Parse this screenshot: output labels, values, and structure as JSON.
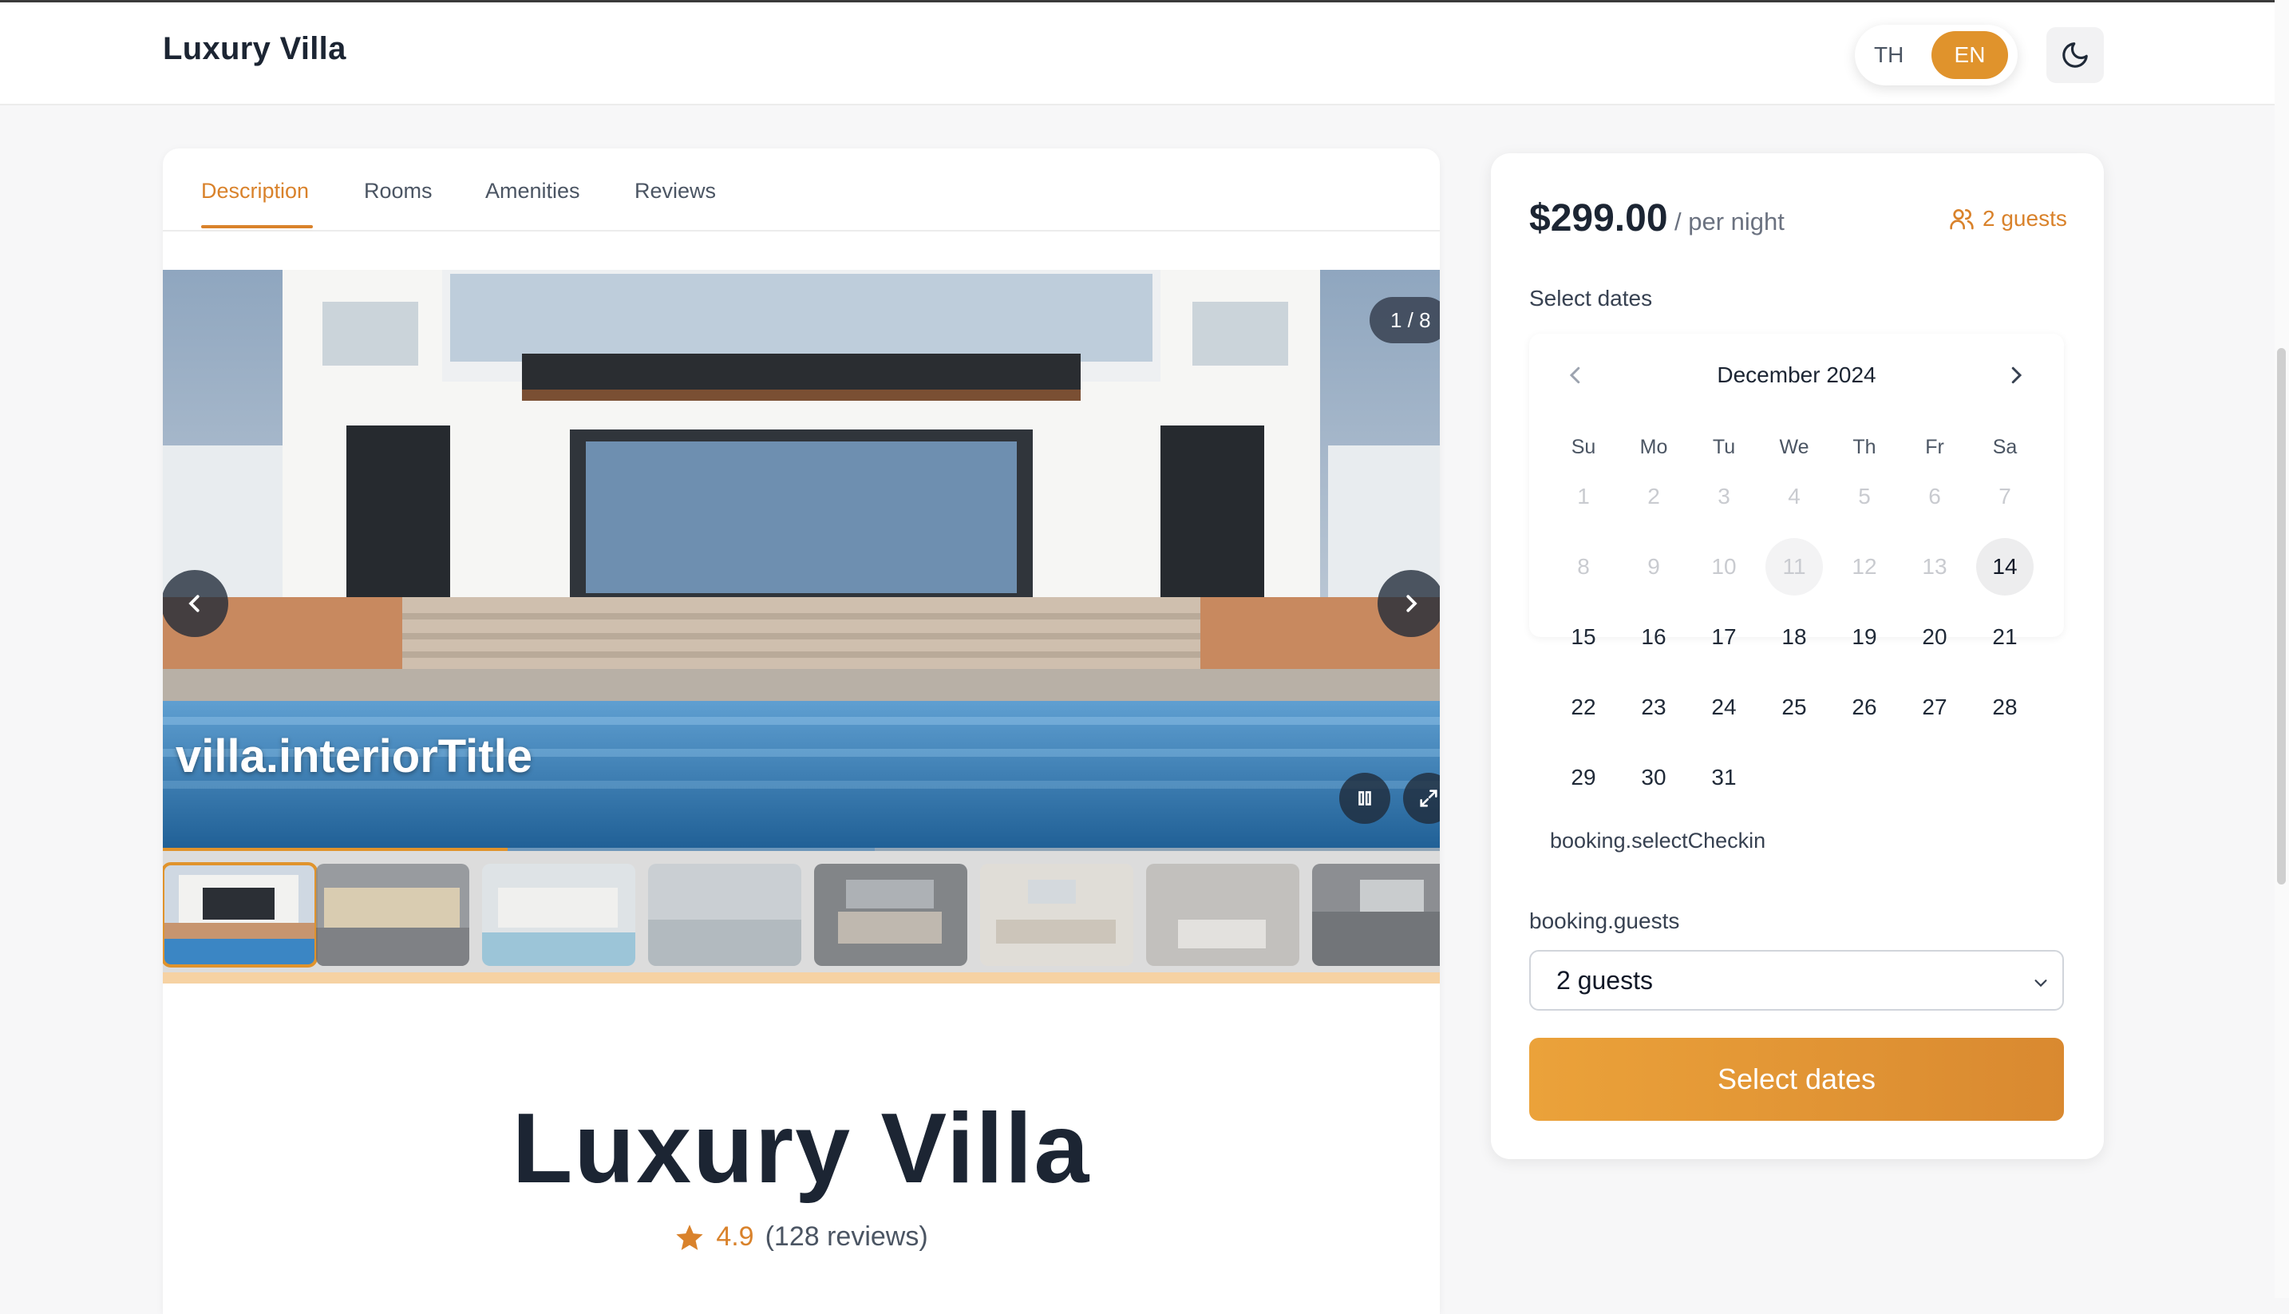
{
  "header": {
    "brand": "Luxury Villa",
    "lang_th": "TH",
    "lang_en": "EN",
    "dark_mode_icon": "moon-icon"
  },
  "tabs": [
    {
      "label": "Description",
      "active": true
    },
    {
      "label": "Rooms",
      "active": false
    },
    {
      "label": "Amenities",
      "active": false
    },
    {
      "label": "Reviews",
      "active": false
    }
  ],
  "gallery": {
    "counter": "1 / 8",
    "caption": "villa.interiorTitle",
    "progress_fraction": 0.27,
    "icons": {
      "prev": "chevron-left-icon",
      "next": "chevron-right-icon",
      "pause": "pause-icon",
      "fullscreen": "expand-icon"
    }
  },
  "villa": {
    "title": "Luxury Villa",
    "rating": "4.9",
    "reviews": "(128 reviews)",
    "star_icon": "star-icon"
  },
  "booking": {
    "price": "$299.00",
    "per_night": "/ per night",
    "guests_badge": "2 guests",
    "select_dates_label": "Select dates",
    "calendar": {
      "month": "December 2024",
      "weekdays": [
        "Su",
        "Mo",
        "Tu",
        "We",
        "Th",
        "Fr",
        "Sa"
      ],
      "days": [
        "1",
        "2",
        "3",
        "4",
        "5",
        "6",
        "7",
        "8",
        "9",
        "10",
        "11",
        "12",
        "13",
        "14",
        "15",
        "16",
        "17",
        "18",
        "19",
        "20",
        "21",
        "22",
        "23",
        "24",
        "25",
        "26",
        "27",
        "28",
        "29",
        "30",
        "31"
      ],
      "disabled_through": 13,
      "today": 14,
      "hint": "booking.selectCheckin"
    },
    "guests_label": "booking.guests",
    "guests_value": "2 guests",
    "button_label": "Select dates"
  },
  "colors": {
    "accent": "#e0932c",
    "accent_text": "#d9822b",
    "dark_text": "#1c2533"
  }
}
